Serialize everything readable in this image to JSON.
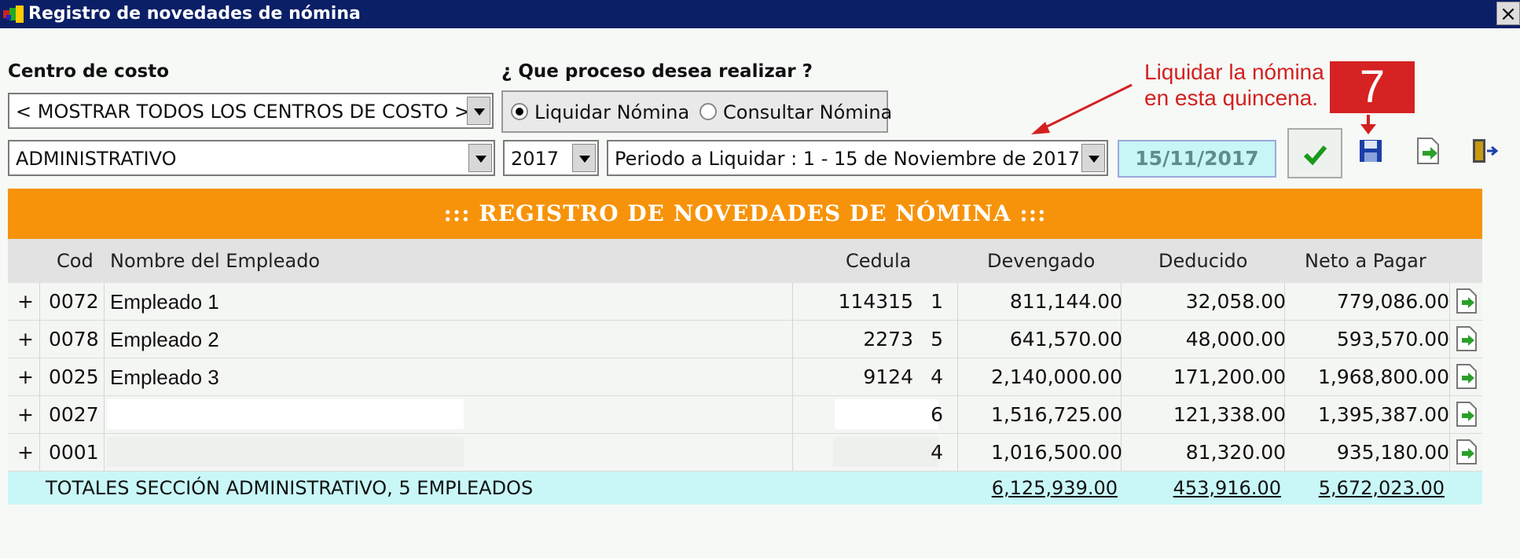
{
  "window": {
    "title": "Registro de novedades de nómina",
    "close_label": "×"
  },
  "form": {
    "cost_center_label": "Centro de costo",
    "process_label": "¿ Que proceso desea realizar ?",
    "cost_center_value": "< MOSTRAR TODOS LOS CENTROS DE COSTO >",
    "section_value": "ADMINISTRATIVO",
    "year_value": "2017",
    "period_value": "Periodo a Liquidar : 1 - 15 de Noviembre de 2017",
    "date_value": "15/11/2017",
    "radio_liquidar": "Liquidar Nómina",
    "radio_consultar": "Consultar Nómina"
  },
  "annotation": {
    "line1": "Liquidar la nómina",
    "line2": "en esta quincena.",
    "badge": "7"
  },
  "banner": {
    "title": "::: REGISTRO DE NOVEDADES DE NÓMINA :::"
  },
  "table": {
    "headers": {
      "cod": "Cod",
      "name": "Nombre del Empleado",
      "cedula": "Cedula",
      "devengado": "Devengado",
      "deducido": "Deducido",
      "neto": "Neto a Pagar"
    },
    "rows": [
      {
        "expand": "+",
        "cod": "0072",
        "name": "Empleado 1",
        "ced_a": "114315",
        "ced_b": "1",
        "devengado": "811,144.00",
        "deducido": "32,058.00",
        "neto": "779,086.00"
      },
      {
        "expand": "+",
        "cod": "0078",
        "name": "Empleado 2",
        "ced_a": "2273",
        "ced_b": "5",
        "devengado": "641,570.00",
        "deducido": "48,000.00",
        "neto": "593,570.00"
      },
      {
        "expand": "+",
        "cod": "0025",
        "name": "Empleado 3",
        "ced_a": "9124",
        "ced_b": "4",
        "devengado": "2,140,000.00",
        "deducido": "171,200.00",
        "neto": "1,968,800.00"
      },
      {
        "expand": "+",
        "cod": "0027",
        "name": "",
        "ced_a": "",
        "ced_b": "6",
        "devengado": "1,516,725.00",
        "deducido": "121,338.00",
        "neto": "1,395,387.00"
      },
      {
        "expand": "+",
        "cod": "0001",
        "name": "",
        "ced_a": "",
        "ced_b": "4",
        "devengado": "1,016,500.00",
        "deducido": "81,320.00",
        "neto": "935,180.00"
      }
    ],
    "totals": {
      "label": "TOTALES SECCIÓN ADMINISTRATIVO, 5 EMPLEADOS",
      "devengado": "6,125,939.00",
      "deducido": "453,916.00",
      "neto": "5,672,023.00"
    }
  },
  "colors": {
    "titlebar": "#0a1f66",
    "banner": "#f7930a",
    "totals": "#c9f7f7",
    "annotation": "#d62222"
  },
  "icons": {
    "ok": "checkmark-icon",
    "save": "floppy-disk-icon",
    "export": "export-document-icon",
    "exit": "exit-door-icon"
  }
}
